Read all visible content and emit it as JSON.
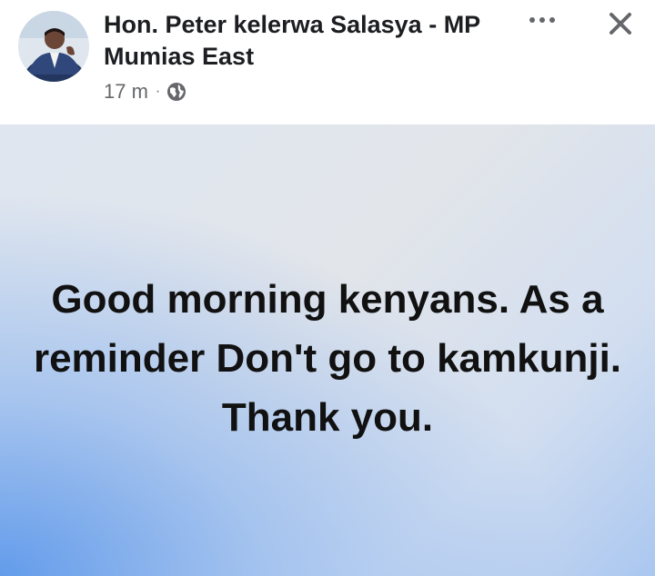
{
  "post": {
    "author_name": "Hon. Peter kelerwa Salasya - MP Mumias East",
    "time": "17 m",
    "separator": "·",
    "privacy_icon": "globe-icon",
    "message": "Good morning kenyans. As a reminder Don't go to kamkunji. Thank you."
  },
  "actions": {
    "more_icon": "more-horizontal-icon",
    "close_icon": "close-icon"
  },
  "colors": {
    "name_text": "#1c1e21",
    "meta_text": "#65676b",
    "message_text": "#111111",
    "background_blue": "#5c98eb",
    "background_gray": "#e2e5ea"
  }
}
